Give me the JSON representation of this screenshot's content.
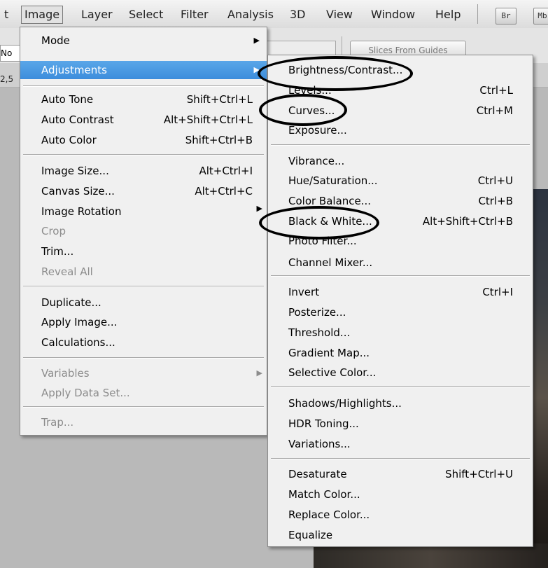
{
  "menubar": {
    "items": [
      {
        "label": "t"
      },
      {
        "label": "Image"
      },
      {
        "label": "Layer"
      },
      {
        "label": "Select"
      },
      {
        "label": "Filter"
      },
      {
        "label": "Analysis"
      },
      {
        "label": "3D"
      },
      {
        "label": "View"
      },
      {
        "label": "Window"
      },
      {
        "label": "Help"
      }
    ],
    "bridge_badge": "Br",
    "minibridge_badge": "Mb"
  },
  "options": {
    "field1_text": "No",
    "field2_text": "2,5",
    "slices_button": "Slices From Guides"
  },
  "image_menu": {
    "items": [
      {
        "label": "Mode",
        "shortcut": "",
        "submenu": true
      },
      {
        "label": "Adjustments",
        "shortcut": "",
        "submenu": true,
        "highlighted": true
      },
      {
        "label": "Auto Tone",
        "shortcut": "Shift+Ctrl+L"
      },
      {
        "label": "Auto Contrast",
        "shortcut": "Alt+Shift+Ctrl+L"
      },
      {
        "label": "Auto Color",
        "shortcut": "Shift+Ctrl+B"
      },
      {
        "label": "Image Size...",
        "shortcut": "Alt+Ctrl+I"
      },
      {
        "label": "Canvas Size...",
        "shortcut": "Alt+Ctrl+C"
      },
      {
        "label": "Image Rotation",
        "shortcut": "",
        "submenu": true
      },
      {
        "label": "Crop",
        "shortcut": "",
        "disabled": true
      },
      {
        "label": "Trim...",
        "shortcut": ""
      },
      {
        "label": "Reveal All",
        "shortcut": "",
        "disabled": true
      },
      {
        "label": "Duplicate...",
        "shortcut": ""
      },
      {
        "label": "Apply Image...",
        "shortcut": ""
      },
      {
        "label": "Calculations...",
        "shortcut": ""
      },
      {
        "label": "Variables",
        "shortcut": "",
        "submenu": true,
        "disabled": true
      },
      {
        "label": "Apply Data Set...",
        "shortcut": "",
        "disabled": true
      },
      {
        "label": "Trap...",
        "shortcut": "",
        "disabled": true
      }
    ]
  },
  "adjustments_menu": {
    "items": [
      {
        "label": "Brightness/Contrast...",
        "shortcut": "",
        "circled": true
      },
      {
        "label": "Levels...",
        "shortcut": "Ctrl+L"
      },
      {
        "label": "Curves...",
        "shortcut": "Ctrl+M",
        "circled": true
      },
      {
        "label": "Exposure...",
        "shortcut": ""
      },
      {
        "label": "Vibrance...",
        "shortcut": ""
      },
      {
        "label": "Hue/Saturation...",
        "shortcut": "Ctrl+U"
      },
      {
        "label": "Color Balance...",
        "shortcut": "Ctrl+B"
      },
      {
        "label": "Black & White...",
        "shortcut": "Alt+Shift+Ctrl+B",
        "circled": true
      },
      {
        "label": "Photo Filter...",
        "shortcut": ""
      },
      {
        "label": "Channel Mixer...",
        "shortcut": ""
      },
      {
        "label": "Invert",
        "shortcut": "Ctrl+I"
      },
      {
        "label": "Posterize...",
        "shortcut": ""
      },
      {
        "label": "Threshold...",
        "shortcut": ""
      },
      {
        "label": "Gradient Map...",
        "shortcut": ""
      },
      {
        "label": "Selective Color...",
        "shortcut": ""
      },
      {
        "label": "Shadows/Highlights...",
        "shortcut": ""
      },
      {
        "label": "HDR Toning...",
        "shortcut": ""
      },
      {
        "label": "Variations...",
        "shortcut": ""
      },
      {
        "label": "Desaturate",
        "shortcut": "Shift+Ctrl+U"
      },
      {
        "label": "Match Color...",
        "shortcut": ""
      },
      {
        "label": "Replace Color...",
        "shortcut": ""
      },
      {
        "label": "Equalize",
        "shortcut": ""
      }
    ]
  },
  "colors": {
    "highlight": "#3c8ddc",
    "menu_bg": "#f0f0f0",
    "disabled_text": "#8c8c8c",
    "annotation": "#000000"
  }
}
